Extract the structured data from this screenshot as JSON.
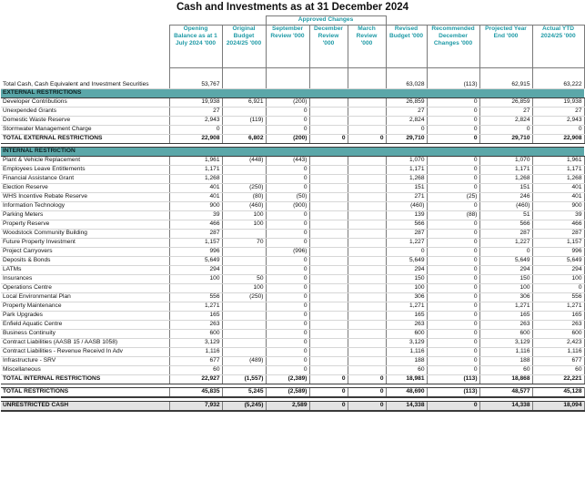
{
  "title": "Cash and Investments as at 31 December 2024",
  "approved_changes_label": "Approved Changes",
  "headers": [
    "Opening Balance as at 1 July 2024 '000",
    "Original Budget 2024/25 '000",
    "September Review '000",
    "December Review '000",
    "March Review '000",
    "Revised Budget '000",
    "Recommended December Changes '000",
    "Projected Year End '000",
    "Actual YTD 2024/25 '000"
  ],
  "total_cash": {
    "label": "Total Cash, Cash Equivalent and Investment Securities",
    "values": [
      "53,767",
      "",
      "",
      "",
      "",
      "63,028",
      "(113)",
      "62,915",
      "63,222"
    ]
  },
  "external": {
    "title": "EXTERNAL RESTRICTIONS",
    "rows": [
      {
        "label": "Developer Contributions",
        "values": [
          "19,938",
          "6,921",
          "(200)",
          "",
          "",
          "26,859",
          "0",
          "26,859",
          "19,938"
        ]
      },
      {
        "label": "Unexpended Grants",
        "values": [
          "27",
          "",
          "0",
          "",
          "",
          "27",
          "0",
          "27",
          "27"
        ]
      },
      {
        "label": "Domestic Waste Reserve",
        "values": [
          "2,943",
          "(119)",
          "0",
          "",
          "",
          "2,824",
          "0",
          "2,824",
          "2,943"
        ]
      },
      {
        "label": "Stormwater Management Charge",
        "values": [
          "0",
          "",
          "0",
          "",
          "",
          "0",
          "0",
          "0",
          "0"
        ]
      }
    ],
    "total": {
      "label": "TOTAL EXTERNAL RESTRICTIONS",
      "values": [
        "22,908",
        "6,802",
        "(200)",
        "0",
        "0",
        "29,710",
        "0",
        "29,710",
        "22,908"
      ]
    }
  },
  "internal": {
    "title": "INTERNAL RESTRICTION",
    "rows": [
      {
        "label": "Plant & Vehicle Replacement",
        "values": [
          "1,961",
          "(448)",
          "(443)",
          "",
          "",
          "1,070",
          "0",
          "1,070",
          "1,961"
        ]
      },
      {
        "label": "Employees Leave Entitlements",
        "values": [
          "1,171",
          "",
          "0",
          "",
          "",
          "1,171",
          "0",
          "1,171",
          "1,171"
        ]
      },
      {
        "label": "Financial Assistance Grant",
        "values": [
          "1,268",
          "",
          "0",
          "",
          "",
          "1,268",
          "0",
          "1,268",
          "1,268"
        ]
      },
      {
        "label": "Election Reserve",
        "values": [
          "401",
          "(250)",
          "0",
          "",
          "",
          "151",
          "0",
          "151",
          "401"
        ]
      },
      {
        "label": "WHS Incentive Rebate Reserve",
        "values": [
          "401",
          "(80)",
          "(50)",
          "",
          "",
          "271",
          "(25)",
          "246",
          "401"
        ]
      },
      {
        "label": "Information Technology",
        "values": [
          "900",
          "(460)",
          "(900)",
          "",
          "",
          "(460)",
          "0",
          "(460)",
          "900"
        ]
      },
      {
        "label": "Parking Meters",
        "values": [
          "39",
          "100",
          "0",
          "",
          "",
          "139",
          "(88)",
          "51",
          "39"
        ]
      },
      {
        "label": "Property Reserve",
        "values": [
          "466",
          "100",
          "0",
          "",
          "",
          "566",
          "0",
          "566",
          "466"
        ]
      },
      {
        "label": "Woodstock Community Building",
        "values": [
          "287",
          "",
          "0",
          "",
          "",
          "287",
          "0",
          "287",
          "287"
        ]
      },
      {
        "label": "Future Property Investment",
        "values": [
          "1,157",
          "70",
          "0",
          "",
          "",
          "1,227",
          "0",
          "1,227",
          "1,157"
        ]
      },
      {
        "label": "Project Carryovers",
        "values": [
          "996",
          "",
          "(996)",
          "",
          "",
          "0",
          "0",
          "0",
          "996"
        ]
      },
      {
        "label": "Deposits & Bonds",
        "values": [
          "5,649",
          "",
          "0",
          "",
          "",
          "5,649",
          "0",
          "5,649",
          "5,649"
        ]
      },
      {
        "label": "LATMs",
        "values": [
          "294",
          "",
          "0",
          "",
          "",
          "294",
          "0",
          "294",
          "294"
        ]
      },
      {
        "label": "Insurances",
        "values": [
          "100",
          "50",
          "0",
          "",
          "",
          "150",
          "0",
          "150",
          "100"
        ]
      },
      {
        "label": "Operations Centre",
        "values": [
          "",
          "100",
          "0",
          "",
          "",
          "100",
          "0",
          "100",
          "0"
        ]
      },
      {
        "label": "Local Environmental Plan",
        "values": [
          "556",
          "(250)",
          "0",
          "",
          "",
          "306",
          "0",
          "306",
          "556"
        ]
      },
      {
        "label": "Property Maintenance",
        "values": [
          "1,271",
          "",
          "0",
          "",
          "",
          "1,271",
          "0",
          "1,271",
          "1,271"
        ]
      },
      {
        "label": "Park Upgrades",
        "values": [
          "165",
          "",
          "0",
          "",
          "",
          "165",
          "0",
          "165",
          "165"
        ]
      },
      {
        "label": "Enfield Aquatic Centre",
        "values": [
          "263",
          "",
          "0",
          "",
          "",
          "263",
          "0",
          "263",
          "263"
        ]
      },
      {
        "label": "Business Continuity",
        "values": [
          "600",
          "",
          "0",
          "",
          "",
          "600",
          "0",
          "600",
          "600"
        ]
      },
      {
        "label": "Contract Liabilities (AASB 15 / AASB 1058)",
        "values": [
          "3,129",
          "",
          "0",
          "",
          "",
          "3,129",
          "0",
          "3,129",
          "2,423"
        ]
      },
      {
        "label": "Contract Liabilities - Revenue Receivd In Adv",
        "values": [
          "1,116",
          "",
          "0",
          "",
          "",
          "1,116",
          "0",
          "1,116",
          "1,116"
        ]
      },
      {
        "label": "Infrastructure - SRV",
        "values": [
          "677",
          "(489)",
          "0",
          "",
          "",
          "188",
          "0",
          "188",
          "677"
        ]
      },
      {
        "label": "Miscellaneous",
        "values": [
          "60",
          "",
          "0",
          "",
          "",
          "60",
          "0",
          "60",
          "60"
        ]
      }
    ],
    "total": {
      "label": "TOTAL INTERNAL RESTRICTIONS",
      "values": [
        "22,927",
        "(1,557)",
        "(2,389)",
        "0",
        "0",
        "18,981",
        "(113)",
        "18,868",
        "22,221"
      ]
    }
  },
  "total_restrictions": {
    "label": "TOTAL RESTRICTIONS",
    "values": [
      "45,835",
      "5,245",
      "(2,589)",
      "0",
      "0",
      "48,690",
      "(113)",
      "48,577",
      "45,128"
    ]
  },
  "unrestricted": {
    "label": "UNRESTRICTED CASH",
    "values": [
      "7,932",
      "(5,245)",
      "2,589",
      "0",
      "0",
      "14,338",
      "0",
      "14,338",
      "18,094"
    ]
  },
  "colors": {
    "header_text": "#1f9aa6",
    "section_band": "#5ba7a9",
    "unrestricted_band": "#e3e3e3"
  }
}
